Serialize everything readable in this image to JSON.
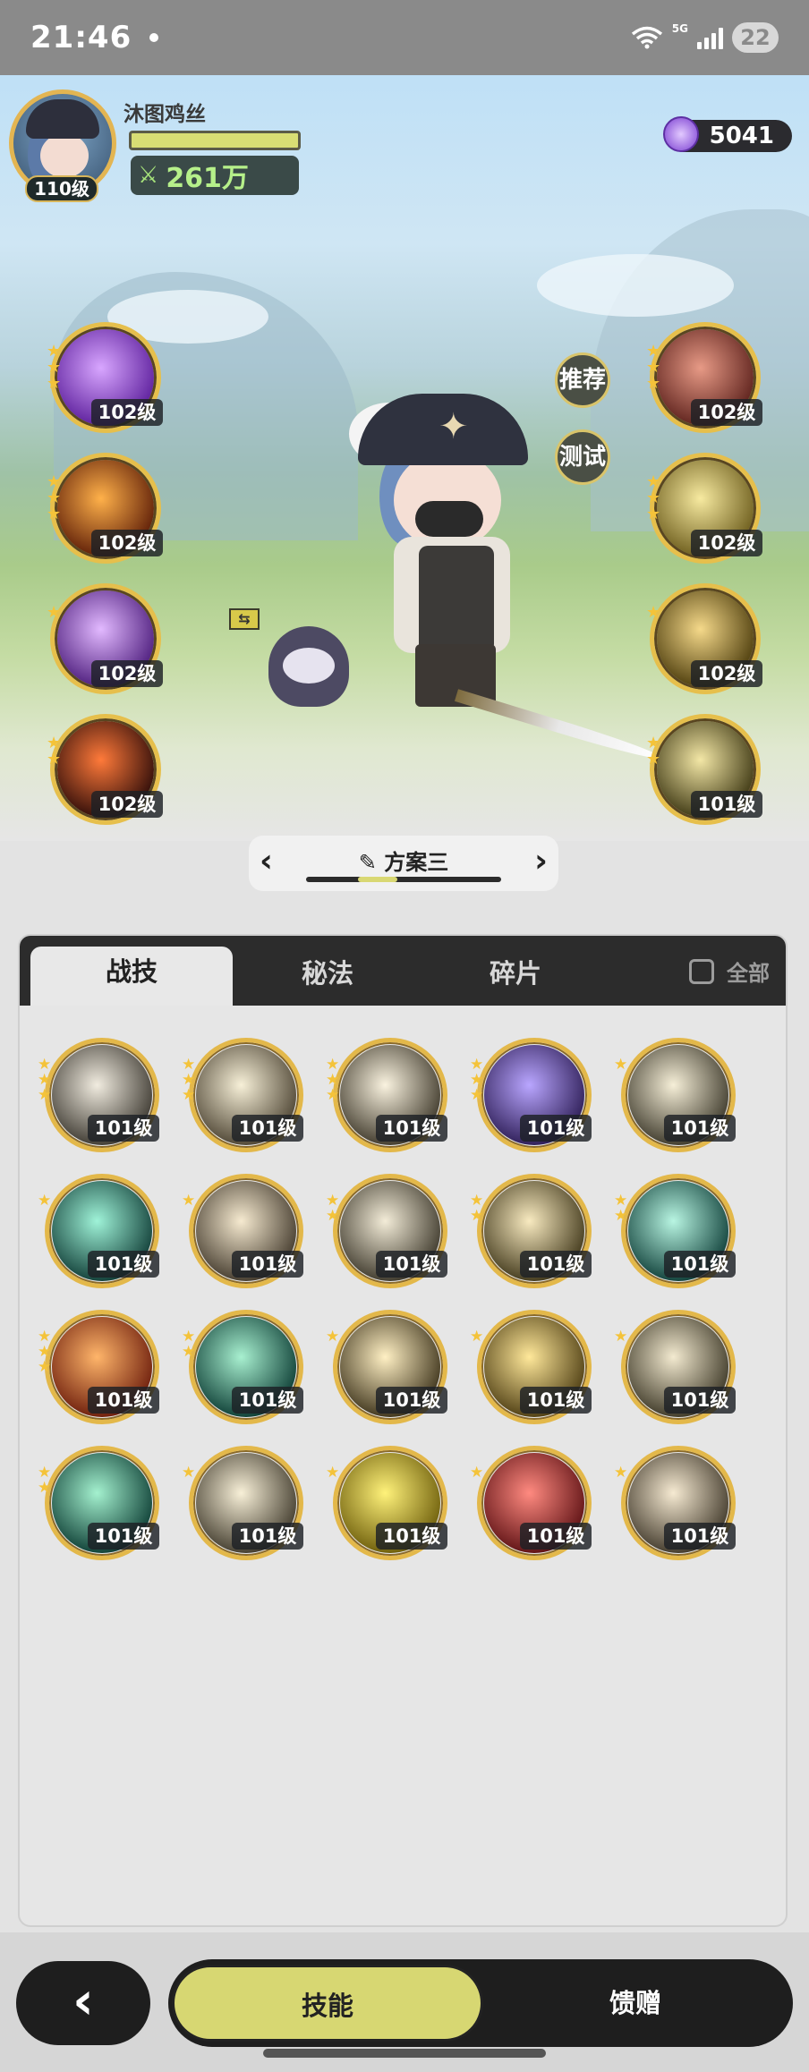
{
  "status_bar": {
    "time": "21:46",
    "network": "5G",
    "battery": "22"
  },
  "player": {
    "name": "沐图鸡丝",
    "level": "110级",
    "power": "261万",
    "gems": "5041"
  },
  "equipped_left": [
    {
      "level": "102级",
      "stars": 3,
      "art": "purple-heart",
      "c1": "#d8a6ff",
      "c2": "#5a1c9a"
    },
    {
      "level": "102级",
      "stars": 3,
      "art": "fire",
      "c1": "#ffb14a",
      "c2": "#5a1a06"
    },
    {
      "level": "102级",
      "stars": 1,
      "art": "purple-flame",
      "c1": "#e2b9ff",
      "c2": "#4a1a7a"
    },
    {
      "level": "102级",
      "stars": 2,
      "art": "red-slash",
      "c1": "#ff7a3a",
      "c2": "#2a0a08"
    }
  ],
  "equipped_right": [
    {
      "level": "102级",
      "stars": 3,
      "art": "red-claw",
      "c1": "#e79a86",
      "c2": "#5a1f1a"
    },
    {
      "level": "102级",
      "stars": 3,
      "art": "eye",
      "c1": "#f7eaa0",
      "c2": "#6a5a1a"
    },
    {
      "level": "102级",
      "stars": 1,
      "art": "vortex",
      "c1": "#f5d98a",
      "c2": "#4a3a0a"
    },
    {
      "level": "101级",
      "stars": 2,
      "art": "skull",
      "c1": "#f3e7a6",
      "c2": "#3a3410"
    }
  ],
  "side_buttons": {
    "recommend": "推荐",
    "test": "测试"
  },
  "loadout": {
    "label": "方案三"
  },
  "tabs": [
    {
      "label": "战技",
      "active": true
    },
    {
      "label": "秘法",
      "active": false
    },
    {
      "label": "碎片",
      "active": false
    }
  ],
  "filter_all": "全部",
  "skills": [
    {
      "level": "101级",
      "stars": 3,
      "art": "beast",
      "c1": "#f1ece0",
      "c2": "#3a362e"
    },
    {
      "level": "101级",
      "stars": 3,
      "art": "crescent",
      "c1": "#f7f0d8",
      "c2": "#4a4130"
    },
    {
      "level": "101级",
      "stars": 3,
      "art": "strike",
      "c1": "#faf3e0",
      "c2": "#3c3628"
    },
    {
      "level": "101级",
      "stars": 3,
      "art": "purple-hand",
      "c1": "#b9a6ff",
      "c2": "#2a1a52"
    },
    {
      "level": "101级",
      "stars": 1,
      "art": "wind",
      "c1": "#f6efd8",
      "c2": "#3a3628"
    },
    {
      "level": "101级",
      "stars": 1,
      "art": "green-wave",
      "c1": "#9ff3d8",
      "c2": "#0e3a34"
    },
    {
      "level": "101级",
      "stars": 1,
      "art": "burst",
      "c1": "#f6ead0",
      "c2": "#40372a"
    },
    {
      "level": "101级",
      "stars": 2,
      "art": "spin",
      "c1": "#f3ecd8",
      "c2": "#3a3528"
    },
    {
      "level": "101级",
      "stars": 2,
      "art": "claw-lines",
      "c1": "#f8eac0",
      "c2": "#3e3518"
    },
    {
      "level": "101级",
      "stars": 2,
      "art": "web",
      "c1": "#b8f5e2",
      "c2": "#0c3c36"
    },
    {
      "level": "101级",
      "stars": 3,
      "art": "fire-sigil",
      "c1": "#ffb56a",
      "c2": "#6a1a0a"
    },
    {
      "level": "101级",
      "stars": 2,
      "art": "green-sword",
      "c1": "#a8f0d0",
      "c2": "#0a3a32"
    },
    {
      "level": "101级",
      "stars": 1,
      "art": "explosion",
      "c1": "#fff0c4",
      "c2": "#3a3018"
    },
    {
      "level": "101级",
      "stars": 1,
      "art": "golden-arc",
      "c1": "#ffe89a",
      "c2": "#4a3a10"
    },
    {
      "level": "101级",
      "stars": 1,
      "art": "shadow-hand",
      "c1": "#f3ead0",
      "c2": "#3a3524"
    },
    {
      "level": "101级",
      "stars": 2,
      "art": "green-arrows",
      "c1": "#a4f1cf",
      "c2": "#0b3b32"
    },
    {
      "level": "101级",
      "stars": 1,
      "art": "sparkle-sword",
      "c1": "#f8f0d8",
      "c2": "#3e382a"
    },
    {
      "level": "101级",
      "stars": 1,
      "art": "gold-orb",
      "c1": "#fff27a",
      "c2": "#6a5a08"
    },
    {
      "level": "101级",
      "stars": 1,
      "art": "red-blade",
      "c1": "#ff8a80",
      "c2": "#5a0f12"
    },
    {
      "level": "101级",
      "stars": 1,
      "art": "elephant",
      "c1": "#f6ead2",
      "c2": "#3e3628"
    }
  ],
  "bottom_nav": {
    "skills": "技能",
    "gift": "馈赠"
  },
  "colors": {
    "accent": "#d7d772",
    "gold_ring": "#e3b84a",
    "tab_bar": "#2c2c2c"
  }
}
